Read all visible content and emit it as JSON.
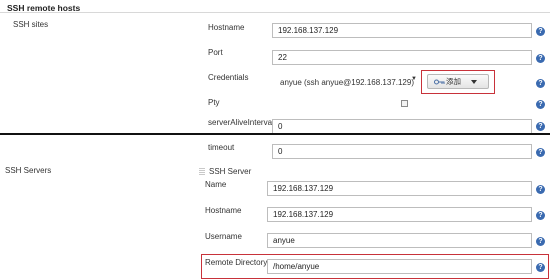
{
  "section_title": "SSH remote hosts",
  "ssh_sites": {
    "label": "SSH sites",
    "hostname": {
      "label": "Hostname",
      "value": "192.168.137.129"
    },
    "port": {
      "label": "Port",
      "value": "22"
    },
    "credentials": {
      "label": "Credentials",
      "value": "anyue (ssh anyue@192.168.137.129)",
      "add_button": "添加"
    },
    "pty": {
      "label": "Pty",
      "checked": false
    },
    "server_alive_interval": {
      "label": "serverAliveInterval",
      "value": "0"
    },
    "timeout": {
      "label": "timeout",
      "value": "0"
    }
  },
  "ssh_servers": {
    "label": "SSH Servers",
    "server_header": "SSH Server",
    "name": {
      "label": "Name",
      "value": "192.168.137.129"
    },
    "hostname": {
      "label": "Hostname",
      "value": "192.168.137.129"
    },
    "username": {
      "label": "Username",
      "value": "anyue"
    },
    "remote_directory": {
      "label": "Remote Directory",
      "value": "/home/anyue"
    }
  },
  "help_glyph": "?",
  "dropdown_glyph": "▼",
  "icons": {
    "help": "help-circle-icon",
    "key": "key-icon",
    "caret": "caret-down-icon",
    "grip": "drag-grip-icon"
  },
  "colors": {
    "highlight_border": "#c8323a",
    "help_icon": "#3a6ab0"
  }
}
